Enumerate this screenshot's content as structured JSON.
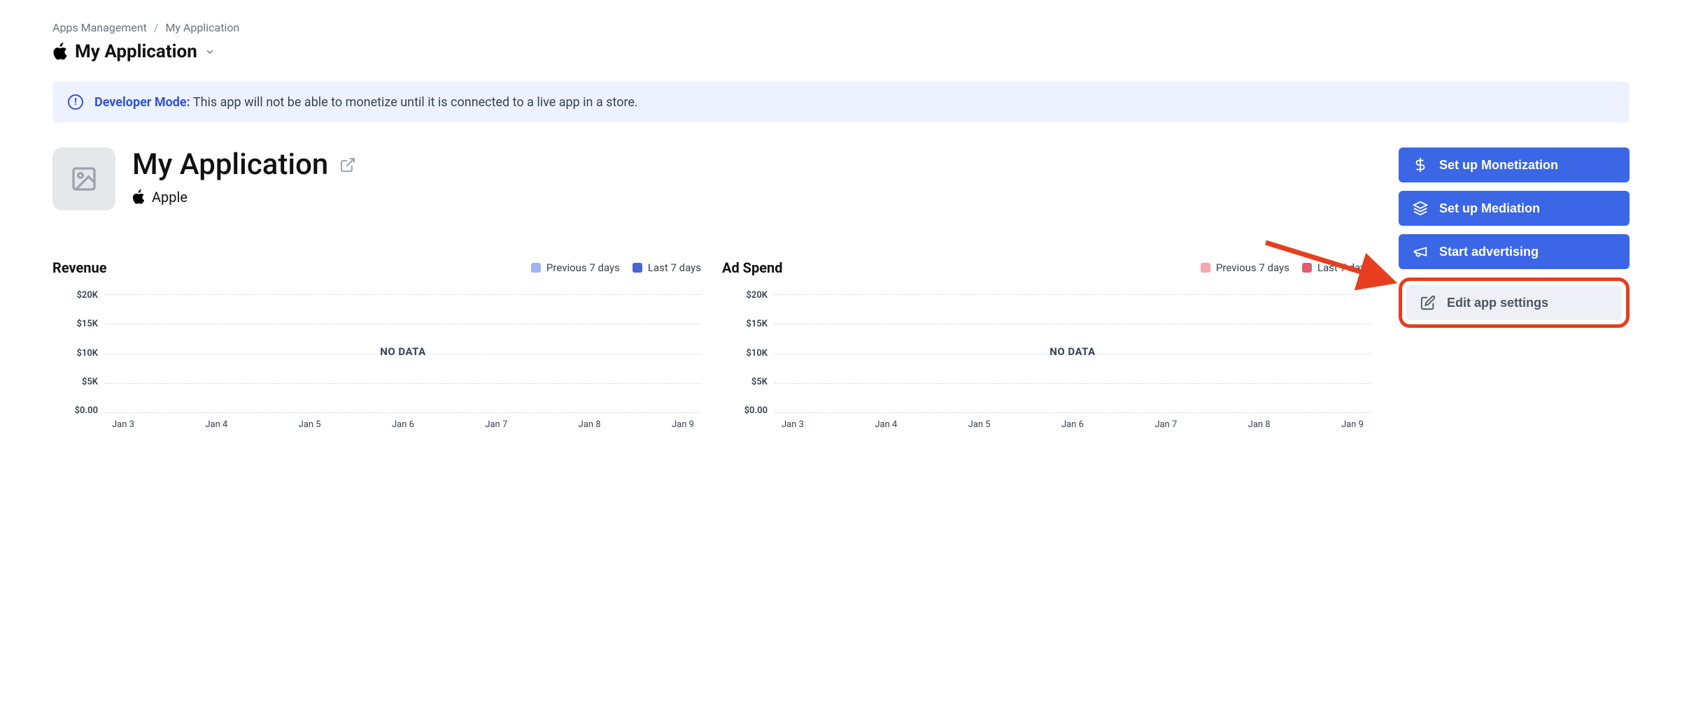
{
  "breadcrumb": {
    "parent": "Apps Management",
    "current": "My Application"
  },
  "app_selector": {
    "name": "My Application"
  },
  "banner": {
    "label": "Developer Mode:",
    "message": "This app will not be able to monetize until it is connected to a live app in a store."
  },
  "app": {
    "name": "My Application",
    "platform": "Apple"
  },
  "actions": {
    "monetization": "Set up Monetization",
    "mediation": "Set up Mediation",
    "advertising": "Start advertising",
    "edit_settings": "Edit app settings"
  },
  "charts": {
    "revenue": {
      "title": "Revenue",
      "legend_prev": "Previous 7 days",
      "legend_last": "Last 7 days",
      "no_data": "NO DATA",
      "color_prev": "#9fb2f3",
      "color_last": "#4a63d6"
    },
    "adspend": {
      "title": "Ad Spend",
      "legend_prev": "Previous 7 days",
      "legend_last": "Last 7 days",
      "no_data": "NO DATA",
      "color_prev": "#f3a6ab",
      "color_last": "#e35d6a"
    },
    "y_ticks": [
      "$20K",
      "$15K",
      "$10K",
      "$5K",
      "$0.00"
    ],
    "x_ticks": [
      "Jan 3",
      "Jan 4",
      "Jan 5",
      "Jan 6",
      "Jan 7",
      "Jan 8",
      "Jan 9"
    ]
  },
  "chart_data": [
    {
      "type": "line",
      "title": "Revenue",
      "xlabel": "",
      "ylabel": "",
      "ylim": [
        0,
        20000
      ],
      "categories": [
        "Jan 3",
        "Jan 4",
        "Jan 5",
        "Jan 6",
        "Jan 7",
        "Jan 8",
        "Jan 9"
      ],
      "series": [
        {
          "name": "Previous 7 days",
          "values": []
        },
        {
          "name": "Last 7 days",
          "values": []
        }
      ],
      "no_data": true
    },
    {
      "type": "line",
      "title": "Ad Spend",
      "xlabel": "",
      "ylabel": "",
      "ylim": [
        0,
        20000
      ],
      "categories": [
        "Jan 3",
        "Jan 4",
        "Jan 5",
        "Jan 6",
        "Jan 7",
        "Jan 8",
        "Jan 9"
      ],
      "series": [
        {
          "name": "Previous 7 days",
          "values": []
        },
        {
          "name": "Last 7 days",
          "values": []
        }
      ],
      "no_data": true
    }
  ]
}
